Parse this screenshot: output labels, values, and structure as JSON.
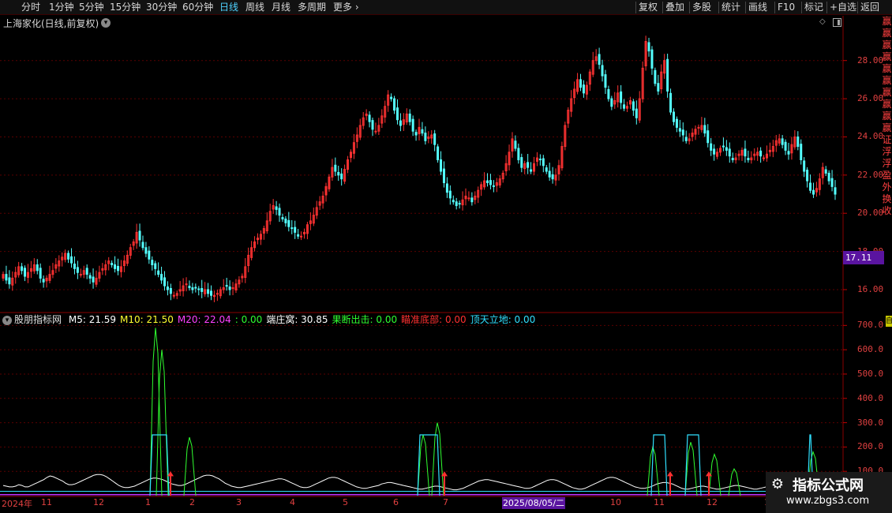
{
  "toolbar": {
    "left_items": [
      "分时",
      "1分钟",
      "5分钟",
      "15分钟",
      "30分钟",
      "60分钟",
      "日线",
      "周线",
      "月线",
      "多周期",
      "更多"
    ],
    "active": "日线",
    "right_items": [
      "复权",
      "叠加",
      "多股",
      "统计",
      "画线",
      "F10",
      "标记",
      "+自选",
      "返回"
    ]
  },
  "stock": {
    "title": "上海家化(日线,前复权)",
    "current_price_label": "17.11"
  },
  "indicator": {
    "name": "股朋指标网",
    "items": [
      {
        "text": "M5: 21.59",
        "color": "#ffffff"
      },
      {
        "text": "M10: 21.50",
        "color": "#ffff30"
      },
      {
        "text": "M20: 22.04",
        "color": "#ff40ff"
      },
      {
        "text": ": 0.00",
        "color": "#30ff30"
      },
      {
        "text": "端庄窝: 30.85",
        "color": "#ffffff"
      },
      {
        "text": "果断出击: 0.00",
        "color": "#30ff30"
      },
      {
        "text": "瞄准底部: 0.00",
        "color": "#ff3030"
      },
      {
        "text": "顶天立地: 0.00",
        "color": "#30e0ff"
      }
    ]
  },
  "price_axis": [
    "28.00",
    "26.00",
    "24.00",
    "22.00",
    "20.00",
    "18.00",
    "16.00"
  ],
  "indicator_axis": [
    "700.0",
    "600.0",
    "500.0",
    "400.0",
    "300.0",
    "200.0",
    "100.0"
  ],
  "right_strip_chars": [
    "赢",
    "赢",
    "赢",
    "赢",
    "赢",
    "赢",
    "赢",
    "赢",
    "赢",
    "赢",
    "证",
    "浮",
    "浮",
    "盈",
    "外",
    "换",
    "收"
  ],
  "yi_box": "自",
  "dates": [
    "2024年",
    "11",
    "12",
    "1",
    "2",
    "3",
    "4",
    "5",
    "6",
    "7",
    "9",
    "10",
    "11",
    "12",
    "1"
  ],
  "date_highlight": "2025/08/05/二",
  "watermark": {
    "line1": "指标公式网",
    "line2": "www.zbgs3.com"
  },
  "colors": {
    "up": "#ff3232",
    "down": "#54ffff",
    "grid": "#5a0000",
    "axis_text": "#e04040"
  },
  "chart_data": {
    "type": "candlestick",
    "price_range": [
      14.8,
      29.6
    ],
    "closes": [
      16.8,
      16.5,
      16.3,
      16.6,
      16.9,
      17.2,
      17.0,
      16.7,
      16.9,
      17.1,
      17.3,
      17.0,
      16.6,
      16.4,
      16.6,
      16.8,
      17.0,
      17.3,
      17.5,
      17.7,
      17.9,
      17.6,
      17.4,
      17.1,
      16.9,
      16.8,
      17.0,
      16.8,
      16.6,
      16.4,
      16.6,
      16.9,
      17.1,
      17.3,
      17.5,
      17.3,
      17.1,
      17.0,
      17.2,
      17.5,
      17.8,
      18.2,
      18.5,
      19.0,
      18.6,
      18.2,
      17.9,
      17.6,
      17.3,
      17.1,
      16.8,
      16.5,
      16.2,
      16.0,
      15.8,
      15.7,
      15.8,
      16.0,
      16.2,
      16.3,
      16.1,
      16.0,
      16.1,
      16.0,
      15.9,
      16.0,
      15.8,
      15.7,
      15.7,
      15.8,
      16.0,
      16.1,
      16.2,
      16.0,
      16.1,
      16.3,
      16.5,
      16.7,
      17.2,
      17.8,
      18.2,
      18.5,
      18.7,
      18.9,
      19.2,
      19.6,
      20.1,
      20.4,
      20.2,
      19.9,
      19.7,
      19.5,
      19.3,
      19.2,
      19.0,
      18.8,
      18.8,
      19.0,
      19.4,
      19.6,
      19.9,
      20.3,
      20.6,
      20.9,
      21.4,
      21.9,
      22.4,
      22.2,
      22.0,
      21.8,
      22.3,
      22.8,
      23.2,
      23.7,
      24.1,
      24.6,
      25.0,
      25.2,
      24.8,
      24.4,
      24.3,
      24.6,
      25.1,
      25.6,
      26.2,
      26.0,
      25.4,
      24.9,
      24.6,
      24.9,
      25.2,
      24.8,
      24.3,
      24.1,
      24.5,
      24.2,
      23.8,
      24.0,
      24.1,
      23.6,
      22.8,
      22.2,
      21.6,
      21.1,
      20.8,
      20.6,
      20.4,
      20.5,
      20.7,
      20.9,
      20.8,
      20.6,
      20.9,
      21.2,
      21.5,
      21.7,
      21.6,
      21.5,
      21.4,
      21.6,
      21.8,
      22.1,
      22.6,
      23.2,
      23.9,
      23.4,
      22.8,
      22.4,
      22.6,
      22.4,
      22.2,
      22.6,
      22.9,
      22.8,
      22.5,
      22.2,
      21.9,
      21.8,
      22.0,
      22.5,
      23.5,
      24.6,
      25.4,
      26.0,
      26.5,
      27.0,
      26.6,
      26.3,
      26.7,
      27.4,
      28.0,
      28.2,
      27.8,
      27.2,
      26.6,
      26.0,
      25.6,
      25.9,
      26.3,
      25.8,
      25.5,
      25.6,
      25.9,
      25.4,
      25.0,
      26.0,
      27.6,
      29.0,
      28.5,
      27.6,
      26.8,
      26.4,
      27.4,
      28.0,
      26.4,
      25.3,
      24.8,
      24.5,
      24.3,
      24.1,
      23.8,
      23.9,
      24.2,
      24.4,
      24.5,
      24.6,
      24.2,
      23.7,
      23.3,
      23.1,
      23.2,
      23.4,
      23.5,
      23.3,
      23.0,
      22.8,
      22.9,
      23.1,
      23.3,
      23.0,
      22.8,
      22.9,
      23.1,
      23.2,
      23.0,
      22.9,
      23.1,
      23.3,
      23.5,
      23.8,
      23.9,
      23.6,
      23.3,
      23.1,
      23.6,
      24.0,
      23.5,
      22.8,
      22.2,
      21.7,
      21.2,
      21.0,
      21.3,
      21.8,
      22.4,
      22.1,
      21.7,
      21.4,
      21.0
    ],
    "indicator_range": [
      0,
      740
    ],
    "ind_white": [
      14,
      13,
      12,
      12,
      13,
      15,
      14,
      12,
      12,
      14,
      16,
      18,
      20,
      22,
      25,
      27,
      26,
      24,
      22,
      20,
      17,
      15,
      15,
      16,
      18,
      20,
      22,
      24,
      26,
      28,
      29,
      29,
      28,
      26,
      23,
      20,
      17,
      14,
      12,
      11,
      11,
      12,
      13,
      15,
      17,
      19,
      21,
      23,
      24,
      24,
      23,
      22,
      20,
      18,
      16,
      15,
      14,
      14,
      15,
      17,
      19,
      21,
      23,
      25,
      27,
      28,
      28,
      27,
      25,
      23,
      20,
      17,
      15,
      13,
      12,
      11,
      11,
      12,
      13,
      14,
      15,
      16,
      17,
      18,
      19,
      20,
      21,
      22,
      23,
      23,
      22,
      20,
      18,
      16,
      14,
      12,
      11,
      11,
      12,
      14,
      16,
      18,
      20,
      22,
      24,
      25,
      25,
      24,
      22,
      20,
      18,
      16,
      14,
      12,
      11,
      10,
      10,
      11,
      12,
      13,
      14,
      16,
      17,
      18,
      18,
      17,
      16,
      15,
      14,
      13,
      12,
      11,
      10,
      9,
      9,
      10,
      11,
      12,
      13,
      13,
      12,
      11,
      10,
      9,
      8,
      8,
      9,
      10,
      12,
      14,
      16,
      18,
      20,
      21,
      22,
      22,
      21,
      20,
      19,
      18,
      17,
      16,
      15,
      14,
      13,
      12,
      11,
      10,
      10,
      11,
      13,
      15,
      17,
      19,
      21,
      22,
      22,
      21,
      19,
      17,
      15,
      13,
      11,
      10,
      9,
      9,
      10,
      12,
      14,
      16,
      18,
      20,
      22,
      24,
      25,
      25,
      24,
      22,
      20,
      18,
      16,
      14,
      12,
      11,
      10,
      10,
      11,
      12,
      14,
      16,
      17,
      18,
      18,
      17,
      16,
      14,
      12,
      10,
      9,
      9,
      10,
      11,
      12,
      13,
      13,
      12,
      11,
      10,
      9,
      9,
      10,
      11,
      12,
      13,
      14,
      14,
      13,
      12,
      11,
      10,
      9,
      9,
      10,
      11,
      12,
      12,
      11,
      10,
      9,
      8,
      8,
      9,
      10,
      11,
      12,
      12,
      11,
      10,
      9,
      8,
      8,
      9,
      10,
      10,
      9,
      8,
      8
    ]
  }
}
